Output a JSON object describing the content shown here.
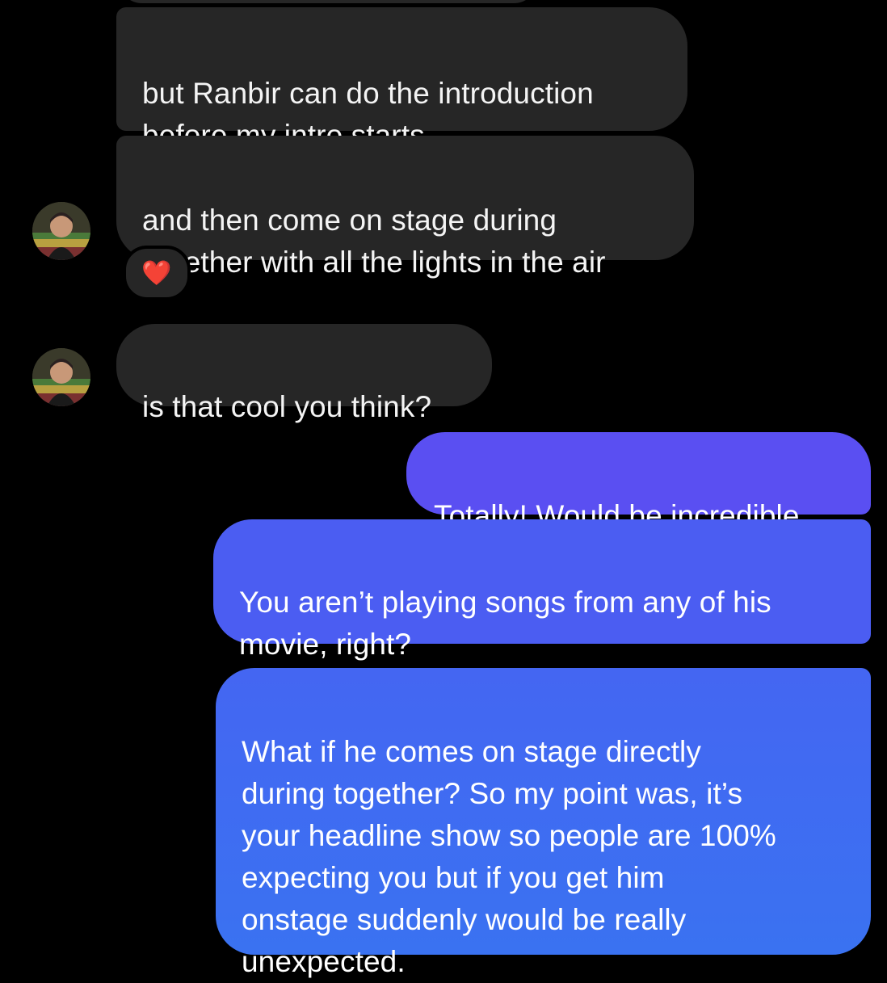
{
  "conversation": {
    "incoming": [
      {
        "id": "msg1",
        "text": "but Ranbir can do the introduction\nbefore my intro starts"
      },
      {
        "id": "msg2",
        "text": "and then come on stage during\ntogether with all the lights in the air",
        "reaction": "❤️"
      },
      {
        "id": "msg3",
        "text": "is that cool you think?"
      }
    ],
    "outgoing": [
      {
        "id": "msg4",
        "text": "Totally! Would be incredible"
      },
      {
        "id": "msg5",
        "text": "You aren’t playing songs from any of his\nmovie, right?"
      },
      {
        "id": "msg6",
        "text": "What if he comes on stage directly\nduring together? So my point was, it’s\nyour headline show so people are 100%\nexpecting you but if you get him\nonstage suddenly would be really\nunexpected."
      }
    ]
  },
  "icons": {
    "avatar": "user-avatar-icon",
    "reaction": "heart-reaction-icon"
  },
  "colors": {
    "background": "#000000",
    "incoming_bubble": "#262626",
    "outgoing_gradient_top": "#5a4ef2",
    "outgoing_gradient_bottom": "#3a72f1"
  }
}
